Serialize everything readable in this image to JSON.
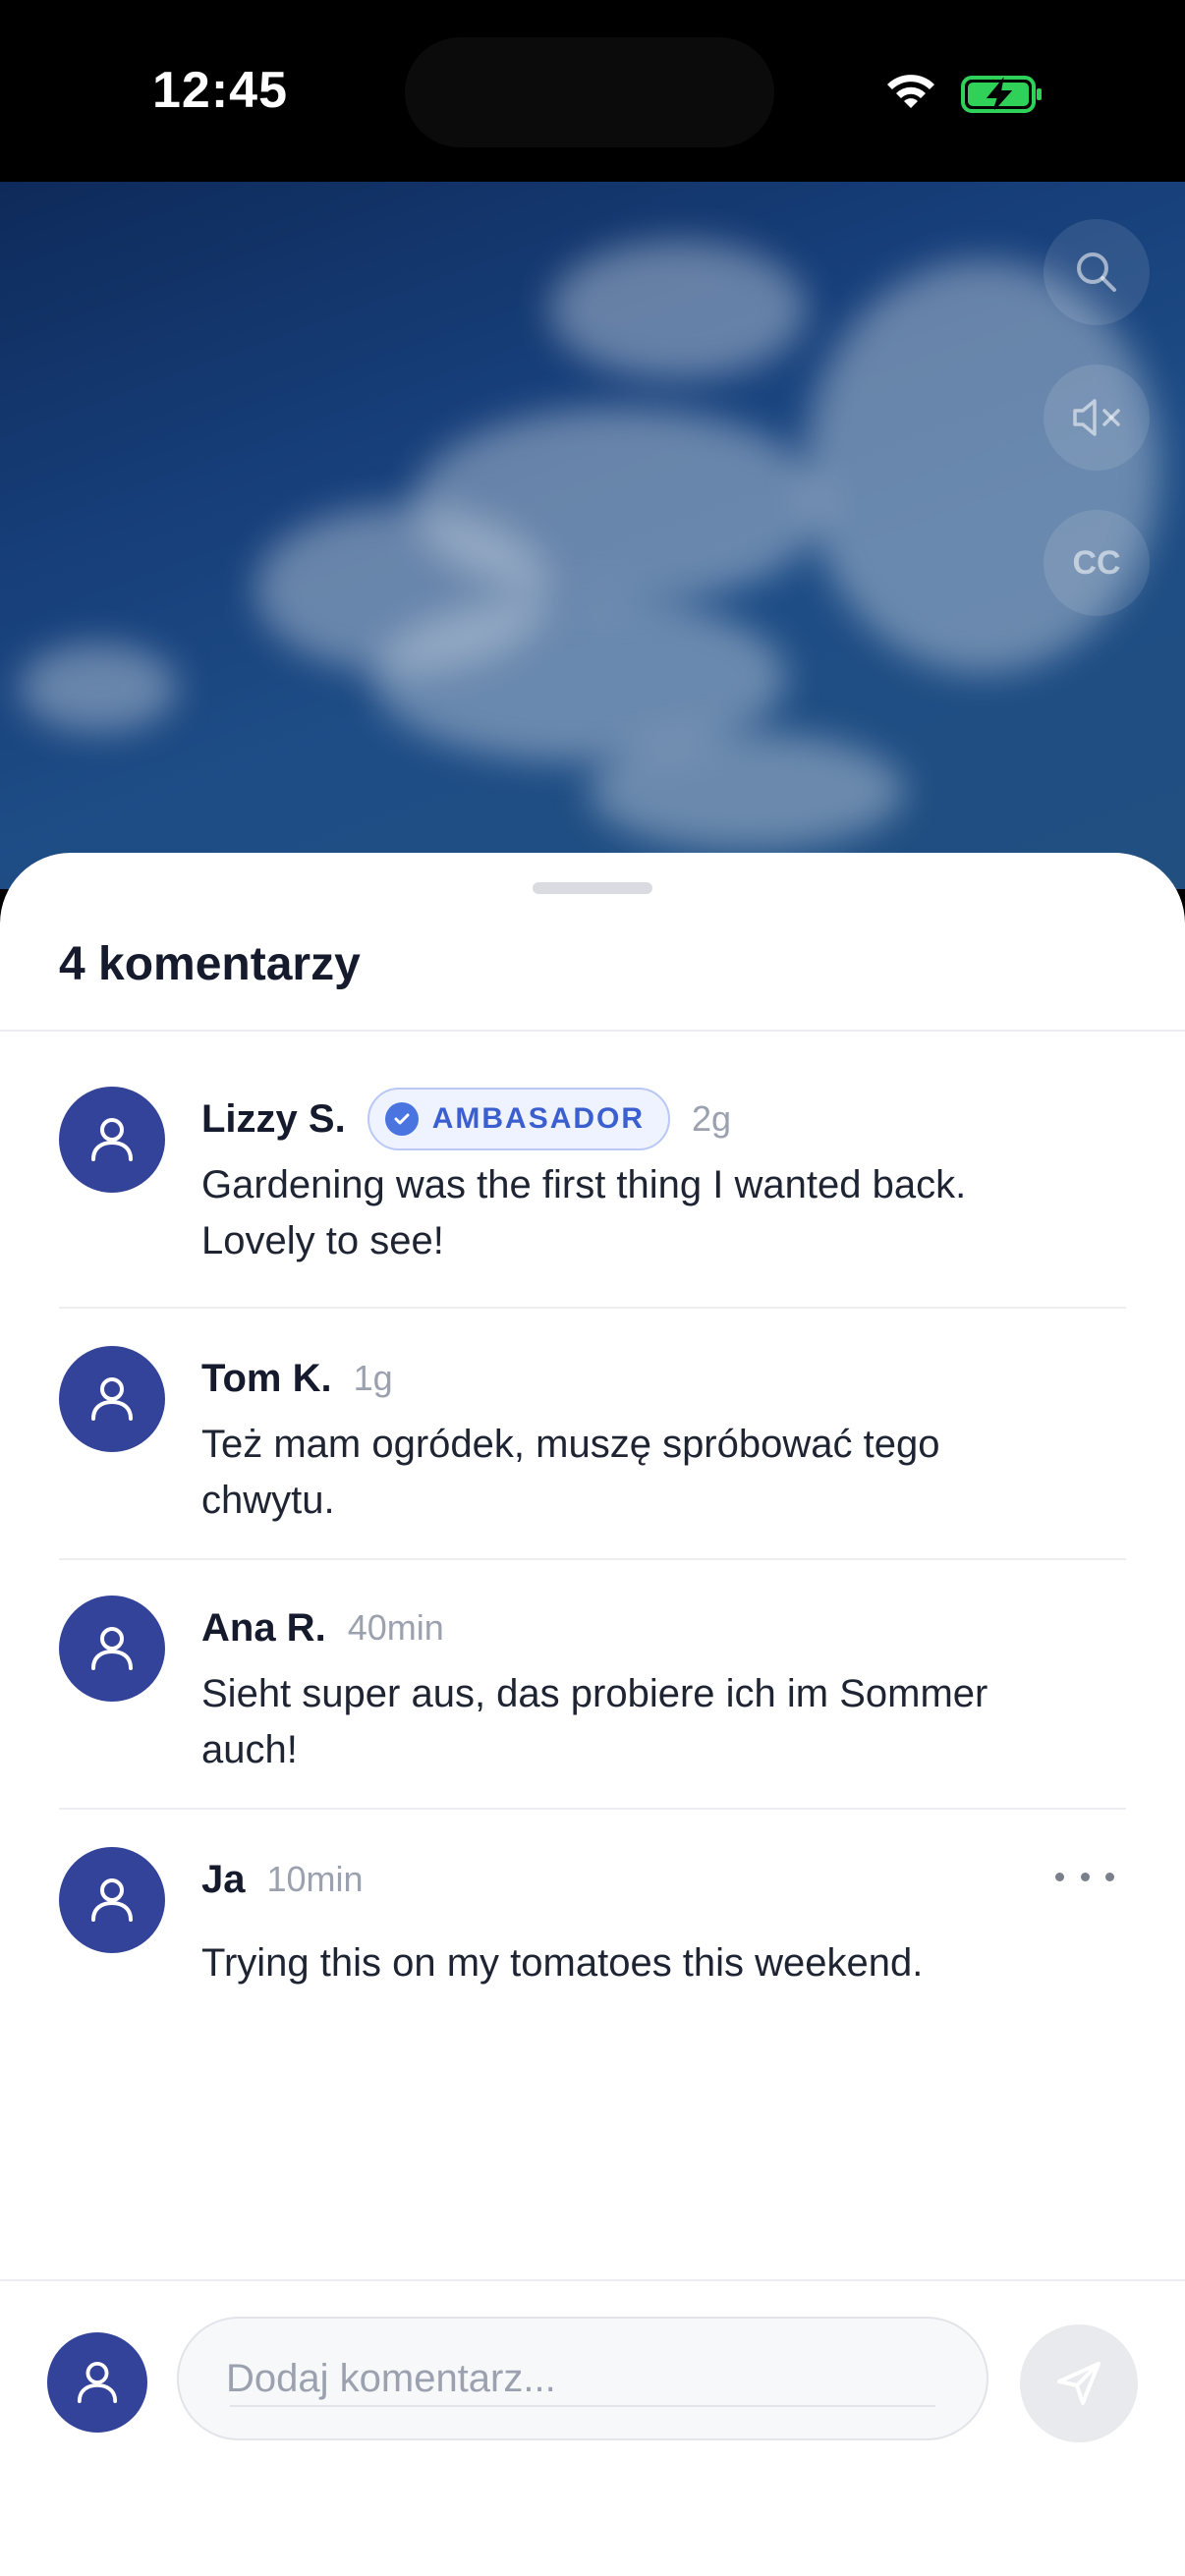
{
  "status_bar": {
    "time": "12:45",
    "icons": [
      "wifi-icon",
      "battery-charging-icon"
    ],
    "battery_color": "#30d158"
  },
  "video": {
    "controls": [
      {
        "name": "search-icon"
      },
      {
        "name": "mute-icon"
      },
      {
        "name": "cc-button",
        "label": "CC"
      }
    ]
  },
  "comments_sheet": {
    "title": "4 komentarzy",
    "comments": [
      {
        "author": "Lizzy S.",
        "badge": "AMBASADOR",
        "time": "2g",
        "text_lines": [
          "Gardening was the first thing I wanted back.",
          "Lovely to see!"
        ]
      },
      {
        "author": "Tom K.",
        "time": "1g",
        "text_lines": [
          "Też mam ogródek, muszę spróbować tego",
          "chwytu."
        ]
      },
      {
        "author": "Ana R.",
        "time": "40min",
        "text_lines": [
          "Sieht super aus, das probiere ich im Sommer",
          "auch!"
        ]
      },
      {
        "author": "Ja",
        "time": "10min",
        "text_lines": [
          "Trying this on my tomatoes this weekend."
        ]
      }
    ]
  },
  "composer": {
    "placeholder": "Dodaj komentarz..."
  },
  "colors": {
    "avatar": "#34439a",
    "badge_text": "#3c5fcf",
    "text_primary": "#151a2d",
    "text_muted": "#9ba1ae"
  }
}
